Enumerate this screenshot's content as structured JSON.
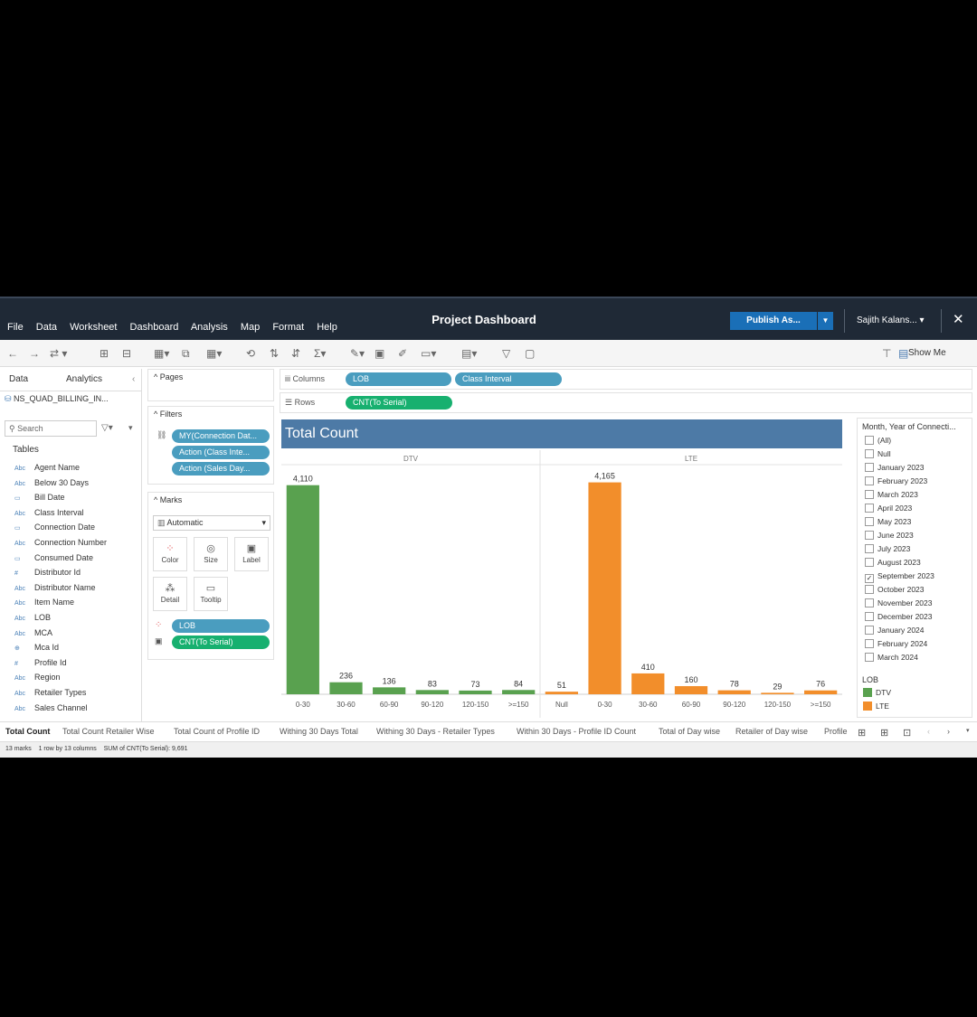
{
  "menu": [
    "File",
    "Data",
    "Worksheet",
    "Dashboard",
    "Analysis",
    "Map",
    "Format",
    "Help"
  ],
  "title": "Project Dashboard",
  "publish_label": "Publish As...",
  "user_label": "Sajith Kalans... ▾",
  "show_me": "Show Me",
  "left_pane": {
    "tab_data": "Data",
    "tab_analytics": "Analytics",
    "datasource": "NS_QUAD_BILLING_IN...",
    "search_placeholder": "Search",
    "tables_header": "Tables",
    "fields": [
      {
        "type": "Abc",
        "name": "Agent Name"
      },
      {
        "type": "Abc",
        "name": "Below 30 Days"
      },
      {
        "type": "date",
        "name": "Bill Date"
      },
      {
        "type": "Abc",
        "name": "Class Interval"
      },
      {
        "type": "date",
        "name": "Connection Date"
      },
      {
        "type": "Abc",
        "name": "Connection Number"
      },
      {
        "type": "date",
        "name": "Consumed Date"
      },
      {
        "type": "#",
        "name": "Distributor Id"
      },
      {
        "type": "Abc",
        "name": "Distributor Name"
      },
      {
        "type": "Abc",
        "name": "Item Name"
      },
      {
        "type": "Abc",
        "name": "LOB"
      },
      {
        "type": "Abc",
        "name": "MCA"
      },
      {
        "type": "geo",
        "name": "Mca Id"
      },
      {
        "type": "#",
        "name": "Profile Id"
      },
      {
        "type": "Abc",
        "name": "Region"
      },
      {
        "type": "Abc",
        "name": "Retailer Types"
      },
      {
        "type": "Abc",
        "name": "Sales Channel"
      }
    ]
  },
  "pages_label": "Pages",
  "filters_label": "Filters",
  "filters": [
    "MY(Connection Dat...",
    "Action (Class Inte...",
    "Action (Sales Day..."
  ],
  "marks_label": "Marks",
  "mark_type": "Automatic",
  "mark_buttons": [
    "Color",
    "Size",
    "Label",
    "Detail",
    "Tooltip"
  ],
  "mark_pills": [
    "LOB",
    "CNT(To Serial)"
  ],
  "columns_label": "Columns",
  "rows_label": "Rows",
  "columns_pills": [
    "LOB",
    "Class Interval"
  ],
  "rows_pills": [
    "CNT(To Serial)"
  ],
  "chart_data": {
    "type": "bar",
    "title": "Total Count",
    "colors": {
      "DTV": "#59a14f",
      "LTE": "#f28e2b"
    },
    "panels": [
      {
        "name": "DTV",
        "categories": [
          "0-30",
          "30-60",
          "60-90",
          "90-120",
          "120-150",
          ">=150"
        ],
        "values": [
          4110,
          236,
          136,
          83,
          73,
          84
        ]
      },
      {
        "name": "LTE",
        "categories": [
          "Null",
          "0-30",
          "30-60",
          "60-90",
          "90-120",
          "120-150",
          ">=150"
        ],
        "values": [
          51,
          4165,
          410,
          160,
          78,
          29,
          76
        ]
      }
    ],
    "ylim": [
      0,
      4300
    ],
    "value_labels": {
      "DTV": [
        "4,110",
        "236",
        "136",
        "83",
        "73",
        "84"
      ],
      "LTE": [
        "51",
        "4,165",
        "410",
        "160",
        "78",
        "29",
        "76"
      ]
    }
  },
  "month_filter": {
    "header": "Month, Year of Connecti...",
    "items": [
      {
        "label": "(All)",
        "checked": false
      },
      {
        "label": "Null",
        "checked": false
      },
      {
        "label": "January 2023",
        "checked": false
      },
      {
        "label": "February 2023",
        "checked": false
      },
      {
        "label": "March 2023",
        "checked": false
      },
      {
        "label": "April 2023",
        "checked": false
      },
      {
        "label": "May 2023",
        "checked": false
      },
      {
        "label": "June 2023",
        "checked": false
      },
      {
        "label": "July 2023",
        "checked": false
      },
      {
        "label": "August 2023",
        "checked": false
      },
      {
        "label": "September 2023",
        "checked": true
      },
      {
        "label": "October 2023",
        "checked": false
      },
      {
        "label": "November 2023",
        "checked": false
      },
      {
        "label": "December 2023",
        "checked": false
      },
      {
        "label": "January 2024",
        "checked": false
      },
      {
        "label": "February 2024",
        "checked": false
      },
      {
        "label": "March 2024",
        "checked": false
      }
    ]
  },
  "legend": {
    "header": "LOB",
    "items": [
      {
        "label": "DTV",
        "color": "#59a14f"
      },
      {
        "label": "LTE",
        "color": "#f28e2b"
      }
    ]
  },
  "sheet_tabs": [
    "Total Count",
    "Total Count Retailer Wise",
    "Total Count of Profile ID",
    "Withing 30 Days Total",
    "Withing 30 Days - Retailer Types",
    "Within 30 Days - Profile ID Count",
    "Total of Day wise",
    "Retailer of Day wise",
    "Profile"
  ],
  "status": {
    "marks": "13 marks",
    "rows": "1 row by 13 columns",
    "sum": "SUM of CNT(To Serial): 9,691"
  }
}
